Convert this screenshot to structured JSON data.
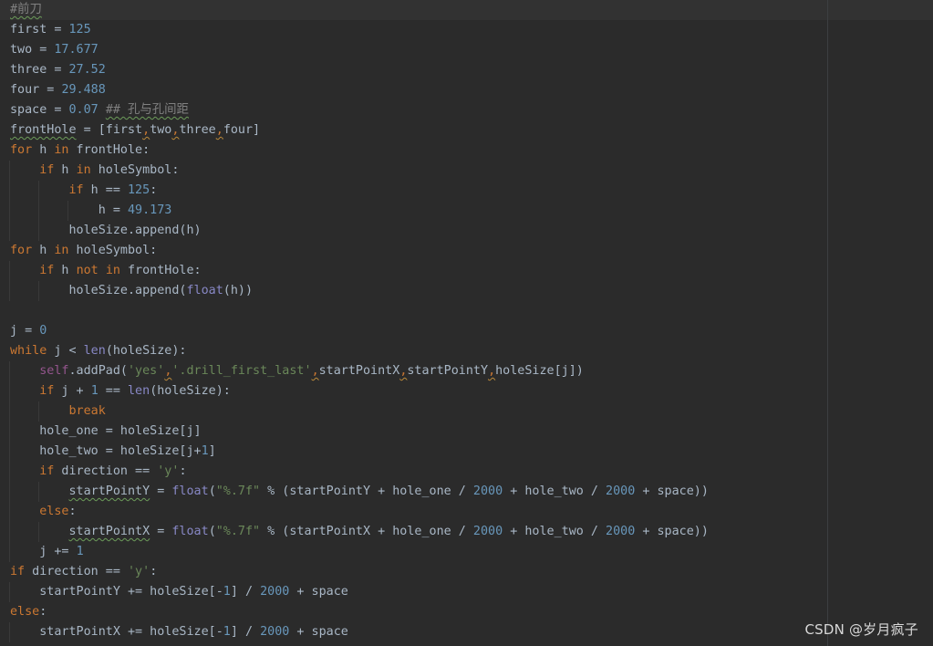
{
  "editor": {
    "language": "python",
    "lines": [
      [
        [
          "#前刀",
          "cm typo"
        ]
      ],
      [
        [
          "first",
          "plain"
        ],
        [
          " = ",
          "plain"
        ],
        [
          "125",
          "num"
        ]
      ],
      [
        [
          "two",
          "plain"
        ],
        [
          " = ",
          "plain"
        ],
        [
          "17.677",
          "num"
        ]
      ],
      [
        [
          "three",
          "plain"
        ],
        [
          " = ",
          "plain"
        ],
        [
          "27.52",
          "num"
        ]
      ],
      [
        [
          "four",
          "plain"
        ],
        [
          " = ",
          "plain"
        ],
        [
          "29.488",
          "num"
        ]
      ],
      [
        [
          "space",
          "plain"
        ],
        [
          " = ",
          "plain"
        ],
        [
          "0.07",
          "num"
        ],
        [
          " ",
          "plain"
        ],
        [
          "## 孔与孔间距",
          "cm typo"
        ]
      ],
      [
        [
          "frontHole",
          "plain typo"
        ],
        [
          " = [first",
          "plain"
        ],
        [
          ",",
          "kw warn"
        ],
        [
          "two",
          "plain"
        ],
        [
          ",",
          "kw warn"
        ],
        [
          "three",
          "plain"
        ],
        [
          ",",
          "kw warn"
        ],
        [
          "four]",
          "plain"
        ]
      ],
      [
        [
          "for",
          "kw"
        ],
        [
          " h ",
          "plain"
        ],
        [
          "in",
          "kw"
        ],
        [
          " frontHole:",
          "plain"
        ]
      ],
      [
        [
          "    ",
          "plain"
        ],
        [
          "if",
          "kw"
        ],
        [
          " h ",
          "plain"
        ],
        [
          "in",
          "kw"
        ],
        [
          " holeSymbol:",
          "plain"
        ]
      ],
      [
        [
          "        ",
          "plain"
        ],
        [
          "if",
          "kw"
        ],
        [
          " h == ",
          "plain"
        ],
        [
          "125",
          "num"
        ],
        [
          ":",
          "plain"
        ]
      ],
      [
        [
          "            h = ",
          "plain"
        ],
        [
          "49.173",
          "num"
        ]
      ],
      [
        [
          "        holeSize.append(h)",
          "plain"
        ]
      ],
      [
        [
          "for",
          "kw"
        ],
        [
          " h ",
          "plain"
        ],
        [
          "in",
          "kw"
        ],
        [
          " holeSymbol:",
          "plain"
        ]
      ],
      [
        [
          "    ",
          "plain"
        ],
        [
          "if",
          "kw"
        ],
        [
          " h ",
          "plain"
        ],
        [
          "not",
          "kw"
        ],
        [
          " ",
          "plain"
        ],
        [
          "in",
          "kw"
        ],
        [
          " frontHole:",
          "plain"
        ]
      ],
      [
        [
          "        holeSize.append(",
          "plain"
        ],
        [
          "float",
          "bi"
        ],
        [
          "(h))",
          "plain"
        ]
      ],
      [],
      [
        [
          "j = ",
          "plain"
        ],
        [
          "0",
          "num"
        ]
      ],
      [
        [
          "while",
          "kw"
        ],
        [
          " j < ",
          "plain"
        ],
        [
          "len",
          "bi"
        ],
        [
          "(holeSize):",
          "plain"
        ]
      ],
      [
        [
          "    ",
          "plain"
        ],
        [
          "self",
          "self"
        ],
        [
          ".addPad(",
          "plain"
        ],
        [
          "'yes'",
          "str"
        ],
        [
          ",",
          "kw warn"
        ],
        [
          "'.drill_first_last'",
          "str"
        ],
        [
          ",",
          "kw warn"
        ],
        [
          "startPointX",
          "plain"
        ],
        [
          ",",
          "kw warn"
        ],
        [
          "startPointY",
          "plain"
        ],
        [
          ",",
          "kw warn"
        ],
        [
          "holeSize[j])",
          "plain"
        ]
      ],
      [
        [
          "    ",
          "plain"
        ],
        [
          "if",
          "kw"
        ],
        [
          " j + ",
          "plain"
        ],
        [
          "1",
          "num"
        ],
        [
          " == ",
          "plain"
        ],
        [
          "len",
          "bi"
        ],
        [
          "(holeSize):",
          "plain"
        ]
      ],
      [
        [
          "        ",
          "plain"
        ],
        [
          "break",
          "kw"
        ]
      ],
      [
        [
          "    hole_one = holeSize[j]",
          "plain"
        ]
      ],
      [
        [
          "    hole_two = holeSize[j+",
          "plain"
        ],
        [
          "1",
          "num"
        ],
        [
          "]",
          "plain"
        ]
      ],
      [
        [
          "    ",
          "plain"
        ],
        [
          "if",
          "kw"
        ],
        [
          " direction == ",
          "plain"
        ],
        [
          "'y'",
          "str"
        ],
        [
          ":",
          "plain"
        ]
      ],
      [
        [
          "        ",
          "plain"
        ],
        [
          "startPointY",
          "plain typo"
        ],
        [
          " = ",
          "plain"
        ],
        [
          "float",
          "bi"
        ],
        [
          "(",
          "plain"
        ],
        [
          "\"%.7f\"",
          "str"
        ],
        [
          " % (startPointY + hole_one / ",
          "plain"
        ],
        [
          "2000",
          "num"
        ],
        [
          " + hole_two / ",
          "plain"
        ],
        [
          "2000",
          "num"
        ],
        [
          " + space))",
          "plain"
        ]
      ],
      [
        [
          "    ",
          "plain"
        ],
        [
          "else",
          "kw"
        ],
        [
          ":",
          "plain"
        ]
      ],
      [
        [
          "        ",
          "plain"
        ],
        [
          "startPointX",
          "plain typo"
        ],
        [
          " = ",
          "plain"
        ],
        [
          "float",
          "bi"
        ],
        [
          "(",
          "plain"
        ],
        [
          "\"%.7f\"",
          "str"
        ],
        [
          " % (startPointX + hole_one / ",
          "plain"
        ],
        [
          "2000",
          "num"
        ],
        [
          " + hole_two / ",
          "plain"
        ],
        [
          "2000",
          "num"
        ],
        [
          " + space))",
          "plain"
        ]
      ],
      [
        [
          "    j += ",
          "plain"
        ],
        [
          "1",
          "num"
        ]
      ],
      [
        [
          "if",
          "kw"
        ],
        [
          " direction == ",
          "plain"
        ],
        [
          "'y'",
          "str"
        ],
        [
          ":",
          "plain"
        ]
      ],
      [
        [
          "    startPointY += holeSize[-",
          "plain"
        ],
        [
          "1",
          "num"
        ],
        [
          "] / ",
          "plain"
        ],
        [
          "2000",
          "num"
        ],
        [
          " + space",
          "plain"
        ]
      ],
      [
        [
          "else",
          "kw"
        ],
        [
          ":",
          "plain"
        ]
      ],
      [
        [
          "    startPointX += holeSize[-",
          "plain"
        ],
        [
          "1",
          "num"
        ],
        [
          "] / ",
          "plain"
        ],
        [
          "2000",
          "num"
        ],
        [
          " + space",
          "plain"
        ]
      ]
    ],
    "colors": {
      "background": "#2b2b2b",
      "keyword": "#cc7832",
      "number": "#6897bb",
      "string": "#6a8759",
      "comment": "#808080",
      "self": "#94558d",
      "builtin": "#8888c6",
      "identifier": "#a9b7c6"
    }
  },
  "watermark": {
    "text": "CSDN @岁月疯子"
  }
}
